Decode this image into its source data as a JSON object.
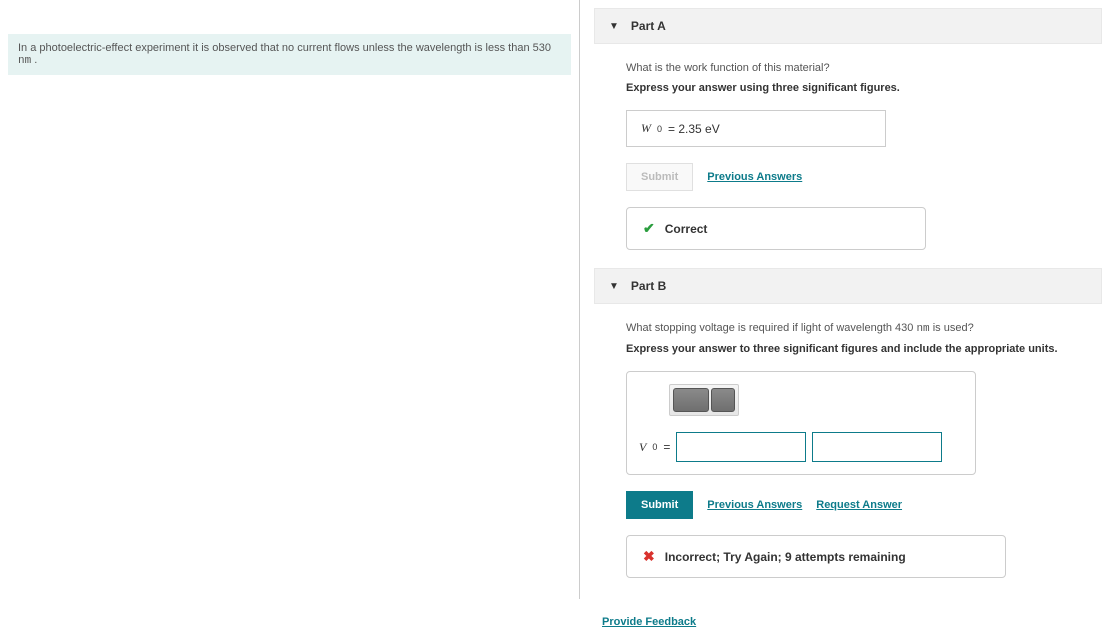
{
  "problem": {
    "prefix": "In a photoelectric-effect experiment it is observed that no current flows unless the wavelength is less than 530 ",
    "unit": "nm",
    "suffix": " ."
  },
  "partA": {
    "header": "Part A",
    "question": "What is the work function of this material?",
    "instruction": "Express your answer using three significant figures.",
    "answer_symbol": "W",
    "answer_sub": "0",
    "answer_value": "= 2.35 eV",
    "submit_label": "Submit",
    "previous_label": "Previous Answers",
    "feedback": "Correct"
  },
  "partB": {
    "header": "Part B",
    "q_prefix": "What stopping voltage is required if light of wavelength 430 ",
    "q_unit": "nm",
    "q_suffix": " is used?",
    "instruction": "Express your answer to three significant figures and include the appropriate units.",
    "symbol": "V",
    "sub": "0",
    "eq": "=",
    "value": "",
    "units": "",
    "submit_label": "Submit",
    "previous_label": "Previous Answers",
    "request_label": "Request Answer",
    "feedback": "Incorrect; Try Again; 9 attempts remaining"
  },
  "provide_feedback": "Provide Feedback"
}
